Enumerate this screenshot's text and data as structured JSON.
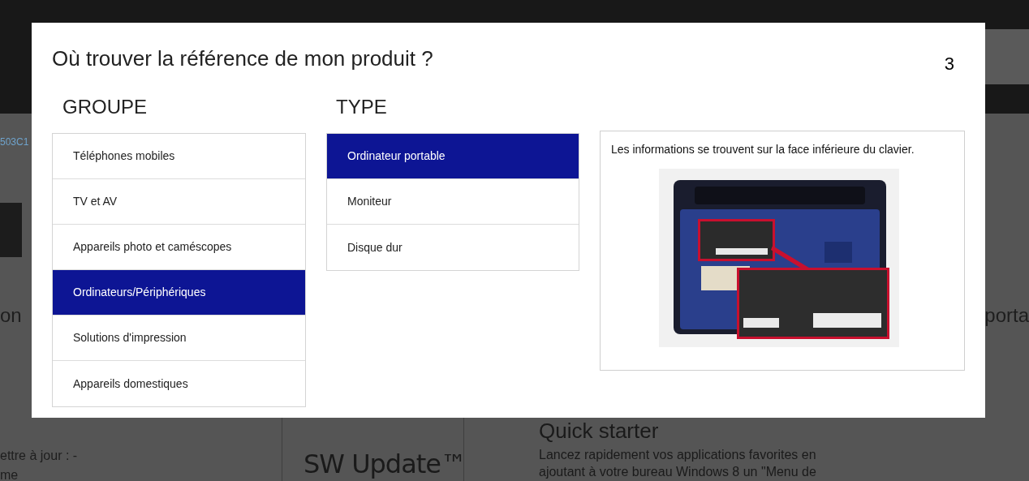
{
  "background": {
    "link_fragment": "503C1",
    "heading_left": "on",
    "heading_right": "porta",
    "left_lines": [
      "ettre à jour : -",
      "me"
    ],
    "logo": "SW Update™",
    "quick_starter": {
      "title": "Quick starter",
      "lines": [
        "Lancez rapidement vos applications favorites en",
        "ajoutant à votre bureau Windows 8 un \"Menu de"
      ]
    }
  },
  "dialog": {
    "title": "Où trouver la référence de mon produit ?",
    "counter": "3",
    "group": {
      "heading": "GROUPE",
      "items": [
        {
          "label": "Téléphones mobiles",
          "selected": false
        },
        {
          "label": "TV et AV",
          "selected": false
        },
        {
          "label": "Appareils photo et caméscopes",
          "selected": false
        },
        {
          "label": "Ordinateurs/Périphériques",
          "selected": true
        },
        {
          "label": "Solutions d'impression",
          "selected": false
        },
        {
          "label": "Appareils domestiques",
          "selected": false
        }
      ]
    },
    "type": {
      "heading": "TYPE",
      "items": [
        {
          "label": "Ordinateur portable",
          "selected": true
        },
        {
          "label": "Moniteur",
          "selected": false
        },
        {
          "label": "Disque dur",
          "selected": false
        }
      ]
    },
    "info": {
      "text": "Les informations se trouvent sur la face inférieure du clavier."
    }
  }
}
